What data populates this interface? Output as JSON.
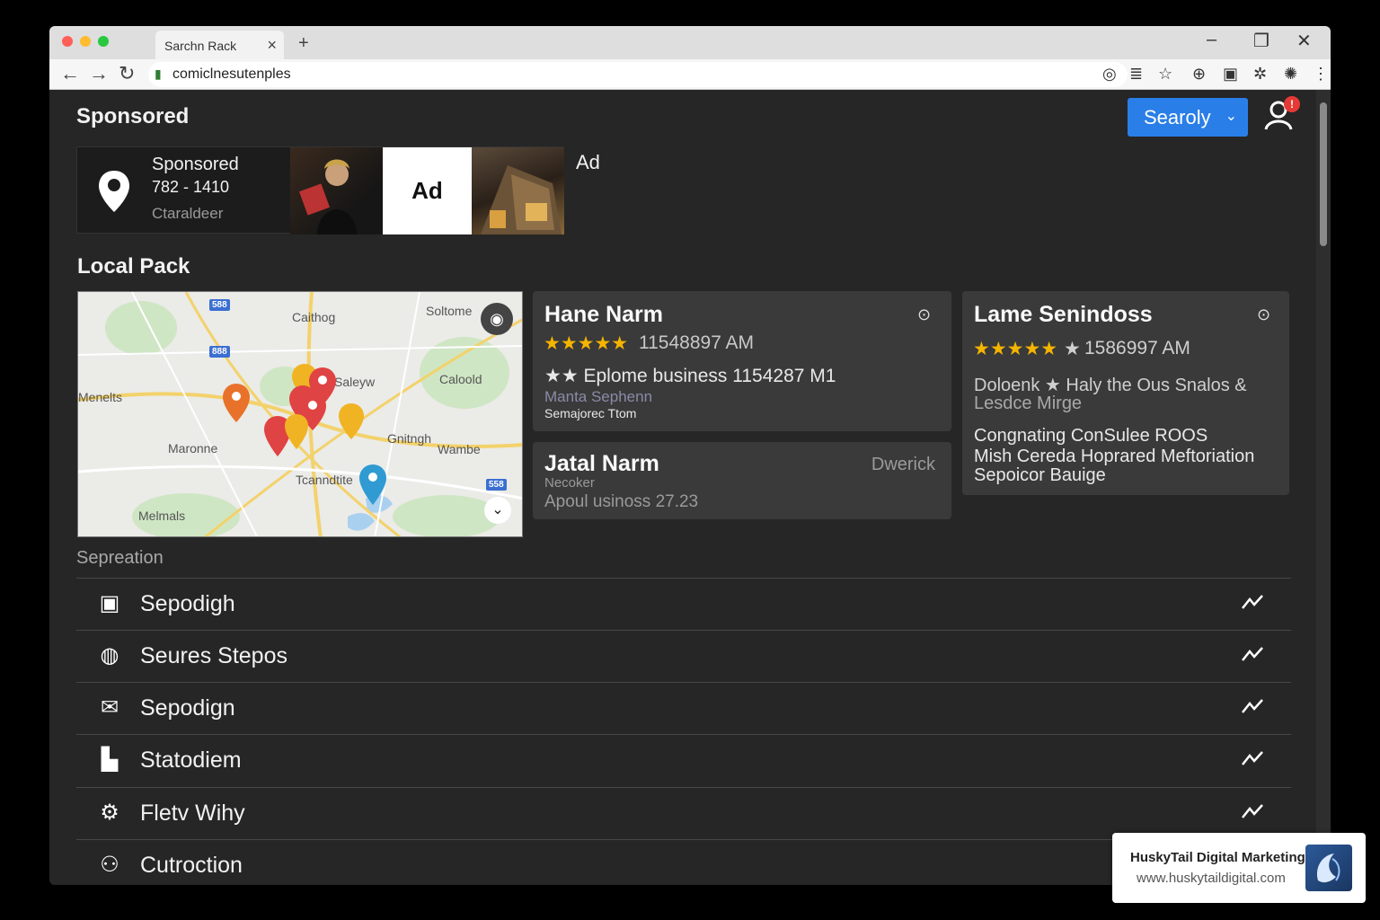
{
  "browser": {
    "tab_title": "Sarchn Rack",
    "tab_close": "×",
    "new_tab": "+",
    "url": "comiclnesutenples",
    "controls": {
      "minimize": "–",
      "restore": "❐",
      "close": "✕"
    }
  },
  "header": {
    "title": "Sponsored",
    "search_button": "Searoly",
    "notification_count": "!"
  },
  "sponsored": {
    "label": "Sponsored",
    "phone": "782 - 1410",
    "subtitle": "Ctaraldeer",
    "ad_tile": "Ad",
    "ad_marker": "Ad"
  },
  "local_pack": {
    "title": "Local Pack",
    "map": {
      "labels": [
        "Caithog",
        "Soltome",
        "Menelts",
        "Saleyw",
        "Caloold",
        "Gnitngh",
        "Maronne",
        "Wambe",
        "Tcanndtite",
        "Melmals"
      ],
      "highways": [
        "588",
        "888",
        "558"
      ]
    },
    "listings": [
      {
        "name": "Hane Narm",
        "stars": "★★★★★",
        "rating_text": "11548897 AM",
        "line2": "★★ Eplome business 1154287 M1",
        "line3": "Manta Sephenn",
        "line4": "Semajorec Ttom"
      },
      {
        "name": "Jatal Narm",
        "tag": "Dwerick",
        "line2": "Necoker",
        "line3": "Apoul usinoss 27.23"
      },
      {
        "name": "Lame Senindoss",
        "stars": "★★★★★",
        "extra_star": "★",
        "rating_text": "1586997 AM",
        "desc1": "Doloenk ★ Haly the Ous Snalos &",
        "desc2": "Lesdce Mirge",
        "desc3": "Congnating ConSulee ROOS",
        "desc4": "Mish Cereda Hoprared Meftoriation",
        "desc5": "Sepoicor Bauige"
      }
    ]
  },
  "results": {
    "section_label": "Sepreation",
    "items": [
      {
        "label": "Sepodigh",
        "icon": "box-icon"
      },
      {
        "label": "Seures Stepos",
        "icon": "palette-icon"
      },
      {
        "label": "Sepodign",
        "icon": "mail-icon"
      },
      {
        "label": "Statodiem",
        "icon": "building-icon"
      },
      {
        "label": "Fletv Wihy",
        "icon": "gear-icon"
      },
      {
        "label": "Cutroction",
        "icon": "people-icon"
      }
    ]
  },
  "branding": {
    "name": "HuskyTail Digital Marketing",
    "url": "www.huskytaildigital.com"
  },
  "colors": {
    "accent": "#2a7ee8",
    "star": "#f5b400",
    "badge": "#e53935"
  }
}
